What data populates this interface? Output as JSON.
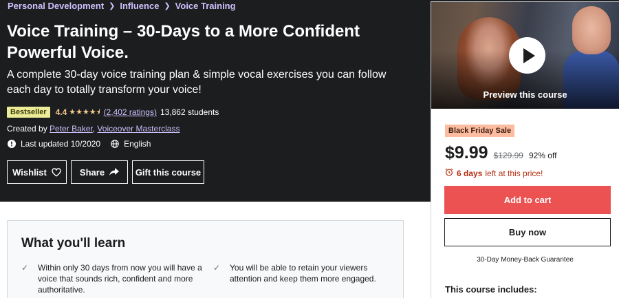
{
  "breadcrumb": {
    "items": [
      "Personal Development",
      "Influence",
      "Voice Training"
    ]
  },
  "course": {
    "title": "Voice Training – 30-Days to a More Confident Powerful Voice.",
    "subtitle": "A complete 30-day voice training plan & simple vocal exercises you can follow each day to totally transform your voice!",
    "badge": "Bestseller",
    "rating": "4.4",
    "stars": 4.4,
    "ratings_count": "(2,402 ratings)",
    "students": "13,862 students",
    "created_by_label": "Created by",
    "instructors": [
      "Peter Baker",
      "Voiceover Masterclass"
    ],
    "last_updated": "Last updated 10/2020",
    "language": "English"
  },
  "actions": {
    "wishlist": "Wishlist",
    "share": "Share",
    "gift": "Gift this course"
  },
  "sidebar": {
    "preview_label": "Preview this course",
    "sale_badge": "Black Friday Sale",
    "price": "$9.99",
    "original_price": "$129.99",
    "discount": "92% off",
    "timer_days": "6 days",
    "timer_rest": "left at this price!",
    "add_to_cart": "Add to cart",
    "buy_now": "Buy now",
    "guarantee": "30-Day Money-Back Guarantee",
    "includes_title": "This course includes:"
  },
  "learn": {
    "title": "What you'll learn",
    "items": [
      "Within only 30 days from now you will have a voice that sounds rich, confident and more authoritative.",
      "You will be able to retain your viewers attention and keep them more engaged."
    ]
  },
  "colors": {
    "hero_bg": "#1c1d1f",
    "link_purple": "#cec0fc",
    "star_gold": "#f3ca8c",
    "bestseller_bg": "#eceb98",
    "sale_bg": "#fcbca0",
    "cart_red": "#ec5252",
    "timer_red": "#b32d0f"
  },
  "icons": {
    "breadcrumb_separator": "chevron-right-icon",
    "updated": "alert-circle-icon",
    "language": "globe-icon",
    "wishlist": "heart-icon",
    "share": "share-arrow-icon",
    "timer": "alarm-clock-icon",
    "preview": "play-icon",
    "learn_item": "check-icon"
  }
}
